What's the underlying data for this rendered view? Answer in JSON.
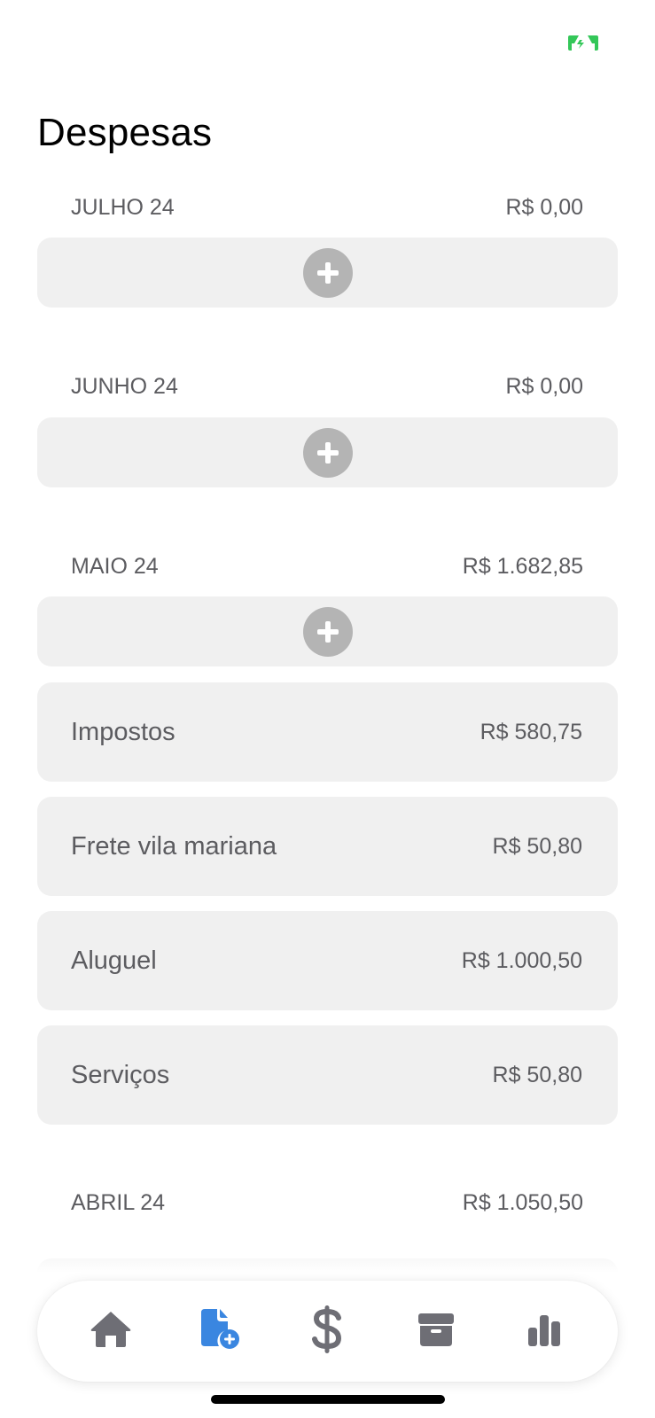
{
  "screen": {
    "title": "Despesas"
  },
  "status_bar": {
    "icon": "battery-charging-icon",
    "icon_color": "#34c759"
  },
  "sections": [
    {
      "month": "JULHO 24",
      "total": "R$ 0,00",
      "items": []
    },
    {
      "month": "JUNHO 24",
      "total": "R$ 0,00",
      "items": []
    },
    {
      "month": "MAIO 24",
      "total": "R$ 1.682,85",
      "items": [
        {
          "name": "Impostos",
          "amount": "R$ 580,75"
        },
        {
          "name": "Frete vila mariana",
          "amount": "R$ 50,80"
        },
        {
          "name": "Aluguel",
          "amount": "R$ 1.000,50"
        },
        {
          "name": "Serviços",
          "amount": "R$ 50,80"
        }
      ]
    },
    {
      "month": "ABRIL 24",
      "total": "R$ 1.050,50"
    }
  ],
  "add_button": {
    "icon": "plus-icon"
  },
  "tab_bar": {
    "tabs": [
      {
        "icon": "home-icon",
        "active": false
      },
      {
        "icon": "add-document-icon",
        "active": true
      },
      {
        "icon": "dollar-icon",
        "active": false
      },
      {
        "icon": "box-icon",
        "active": false
      },
      {
        "icon": "bar-chart-icon",
        "active": false
      }
    ],
    "active_color": "#3a86e0",
    "inactive_color": "#6e6e75"
  },
  "colors": {
    "card_background": "#f0f0f0",
    "add_circle": "#b4b4b4",
    "secondary_text": "#5c5c60"
  }
}
